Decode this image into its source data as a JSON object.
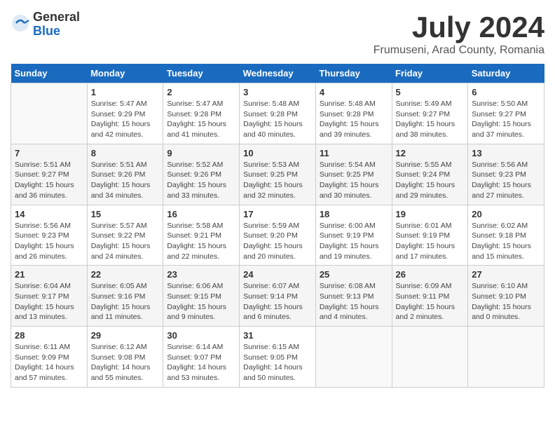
{
  "header": {
    "logo_general": "General",
    "logo_blue": "Blue",
    "title": "July 2024",
    "subtitle": "Frumuseni, Arad County, Romania"
  },
  "calendar": {
    "days_of_week": [
      "Sunday",
      "Monday",
      "Tuesday",
      "Wednesday",
      "Thursday",
      "Friday",
      "Saturday"
    ],
    "weeks": [
      [
        {
          "day": "",
          "details": ""
        },
        {
          "day": "1",
          "details": "Sunrise: 5:47 AM\nSunset: 9:29 PM\nDaylight: 15 hours\nand 42 minutes."
        },
        {
          "day": "2",
          "details": "Sunrise: 5:47 AM\nSunset: 9:28 PM\nDaylight: 15 hours\nand 41 minutes."
        },
        {
          "day": "3",
          "details": "Sunrise: 5:48 AM\nSunset: 9:28 PM\nDaylight: 15 hours\nand 40 minutes."
        },
        {
          "day": "4",
          "details": "Sunrise: 5:48 AM\nSunset: 9:28 PM\nDaylight: 15 hours\nand 39 minutes."
        },
        {
          "day": "5",
          "details": "Sunrise: 5:49 AM\nSunset: 9:27 PM\nDaylight: 15 hours\nand 38 minutes."
        },
        {
          "day": "6",
          "details": "Sunrise: 5:50 AM\nSunset: 9:27 PM\nDaylight: 15 hours\nand 37 minutes."
        }
      ],
      [
        {
          "day": "7",
          "details": "Sunrise: 5:51 AM\nSunset: 9:27 PM\nDaylight: 15 hours\nand 36 minutes."
        },
        {
          "day": "8",
          "details": "Sunrise: 5:51 AM\nSunset: 9:26 PM\nDaylight: 15 hours\nand 34 minutes."
        },
        {
          "day": "9",
          "details": "Sunrise: 5:52 AM\nSunset: 9:26 PM\nDaylight: 15 hours\nand 33 minutes."
        },
        {
          "day": "10",
          "details": "Sunrise: 5:53 AM\nSunset: 9:25 PM\nDaylight: 15 hours\nand 32 minutes."
        },
        {
          "day": "11",
          "details": "Sunrise: 5:54 AM\nSunset: 9:25 PM\nDaylight: 15 hours\nand 30 minutes."
        },
        {
          "day": "12",
          "details": "Sunrise: 5:55 AM\nSunset: 9:24 PM\nDaylight: 15 hours\nand 29 minutes."
        },
        {
          "day": "13",
          "details": "Sunrise: 5:56 AM\nSunset: 9:23 PM\nDaylight: 15 hours\nand 27 minutes."
        }
      ],
      [
        {
          "day": "14",
          "details": "Sunrise: 5:56 AM\nSunset: 9:23 PM\nDaylight: 15 hours\nand 26 minutes."
        },
        {
          "day": "15",
          "details": "Sunrise: 5:57 AM\nSunset: 9:22 PM\nDaylight: 15 hours\nand 24 minutes."
        },
        {
          "day": "16",
          "details": "Sunrise: 5:58 AM\nSunset: 9:21 PM\nDaylight: 15 hours\nand 22 minutes."
        },
        {
          "day": "17",
          "details": "Sunrise: 5:59 AM\nSunset: 9:20 PM\nDaylight: 15 hours\nand 20 minutes."
        },
        {
          "day": "18",
          "details": "Sunrise: 6:00 AM\nSunset: 9:19 PM\nDaylight: 15 hours\nand 19 minutes."
        },
        {
          "day": "19",
          "details": "Sunrise: 6:01 AM\nSunset: 9:19 PM\nDaylight: 15 hours\nand 17 minutes."
        },
        {
          "day": "20",
          "details": "Sunrise: 6:02 AM\nSunset: 9:18 PM\nDaylight: 15 hours\nand 15 minutes."
        }
      ],
      [
        {
          "day": "21",
          "details": "Sunrise: 6:04 AM\nSunset: 9:17 PM\nDaylight: 15 hours\nand 13 minutes."
        },
        {
          "day": "22",
          "details": "Sunrise: 6:05 AM\nSunset: 9:16 PM\nDaylight: 15 hours\nand 11 minutes."
        },
        {
          "day": "23",
          "details": "Sunrise: 6:06 AM\nSunset: 9:15 PM\nDaylight: 15 hours\nand 9 minutes."
        },
        {
          "day": "24",
          "details": "Sunrise: 6:07 AM\nSunset: 9:14 PM\nDaylight: 15 hours\nand 6 minutes."
        },
        {
          "day": "25",
          "details": "Sunrise: 6:08 AM\nSunset: 9:13 PM\nDaylight: 15 hours\nand 4 minutes."
        },
        {
          "day": "26",
          "details": "Sunrise: 6:09 AM\nSunset: 9:11 PM\nDaylight: 15 hours\nand 2 minutes."
        },
        {
          "day": "27",
          "details": "Sunrise: 6:10 AM\nSunset: 9:10 PM\nDaylight: 15 hours\nand 0 minutes."
        }
      ],
      [
        {
          "day": "28",
          "details": "Sunrise: 6:11 AM\nSunset: 9:09 PM\nDaylight: 14 hours\nand 57 minutes."
        },
        {
          "day": "29",
          "details": "Sunrise: 6:12 AM\nSunset: 9:08 PM\nDaylight: 14 hours\nand 55 minutes."
        },
        {
          "day": "30",
          "details": "Sunrise: 6:14 AM\nSunset: 9:07 PM\nDaylight: 14 hours\nand 53 minutes."
        },
        {
          "day": "31",
          "details": "Sunrise: 6:15 AM\nSunset: 9:05 PM\nDaylight: 14 hours\nand 50 minutes."
        },
        {
          "day": "",
          "details": ""
        },
        {
          "day": "",
          "details": ""
        },
        {
          "day": "",
          "details": ""
        }
      ]
    ]
  }
}
